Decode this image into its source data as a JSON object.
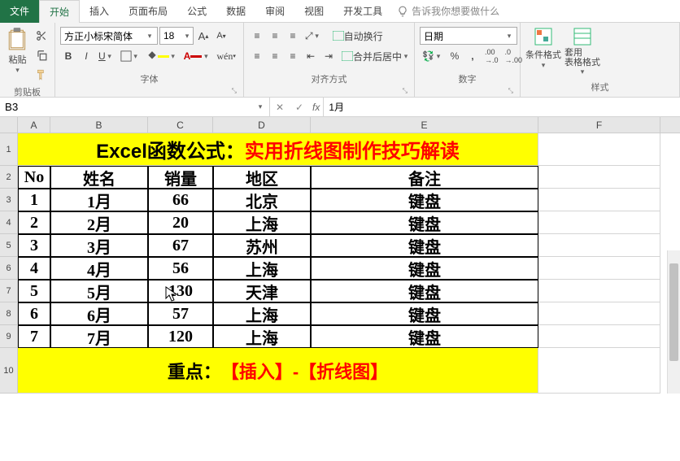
{
  "tabs": {
    "file": "文件",
    "home": "开始",
    "insert": "插入",
    "page_layout": "页面布局",
    "formulas": "公式",
    "data": "数据",
    "review": "审阅",
    "view": "视图",
    "developer": "开发工具",
    "tellme": "告诉我你想要做什么"
  },
  "ribbon": {
    "clipboard": {
      "paste": "粘贴",
      "label": "剪贴板"
    },
    "font": {
      "name": "方正小标宋简体",
      "size": "18",
      "label": "字体"
    },
    "align": {
      "wrap": "自动换行",
      "merge": "合并后居中",
      "label": "对齐方式"
    },
    "number": {
      "format": "日期",
      "label": "数字"
    },
    "styles": {
      "cond": "条件格式",
      "table": "套用\n表格格式",
      "label": "样式"
    }
  },
  "fbar": {
    "name": "B3",
    "formula": "1月"
  },
  "cols": [
    "A",
    "B",
    "C",
    "D",
    "E",
    "F"
  ],
  "rows": [
    "1",
    "2",
    "3",
    "4",
    "5",
    "6",
    "7",
    "8",
    "9",
    "10"
  ],
  "title": {
    "p1": "Excel函数公式：",
    "p2": "实用折线图制作技巧解读"
  },
  "headers": {
    "no": "No",
    "name": "姓名",
    "sales": "销量",
    "area": "地区",
    "remark": "备注"
  },
  "data": [
    {
      "no": "1",
      "name": "1月",
      "sales": "66",
      "area": "北京",
      "remark": "键盘"
    },
    {
      "no": "2",
      "name": "2月",
      "sales": "20",
      "area": "上海",
      "remark": "键盘"
    },
    {
      "no": "3",
      "name": "3月",
      "sales": "67",
      "area": "苏州",
      "remark": "键盘"
    },
    {
      "no": "4",
      "name": "4月",
      "sales": "56",
      "area": "上海",
      "remark": "键盘"
    },
    {
      "no": "5",
      "name": "5月",
      "sales": "130",
      "area": "天津",
      "remark": "键盘"
    },
    {
      "no": "6",
      "name": "6月",
      "sales": "57",
      "area": "上海",
      "remark": "键盘"
    },
    {
      "no": "7",
      "name": "7月",
      "sales": "120",
      "area": "上海",
      "remark": "键盘"
    }
  ],
  "footer": {
    "p1": "重点：",
    "p2": "【插入】-【折线图】"
  }
}
